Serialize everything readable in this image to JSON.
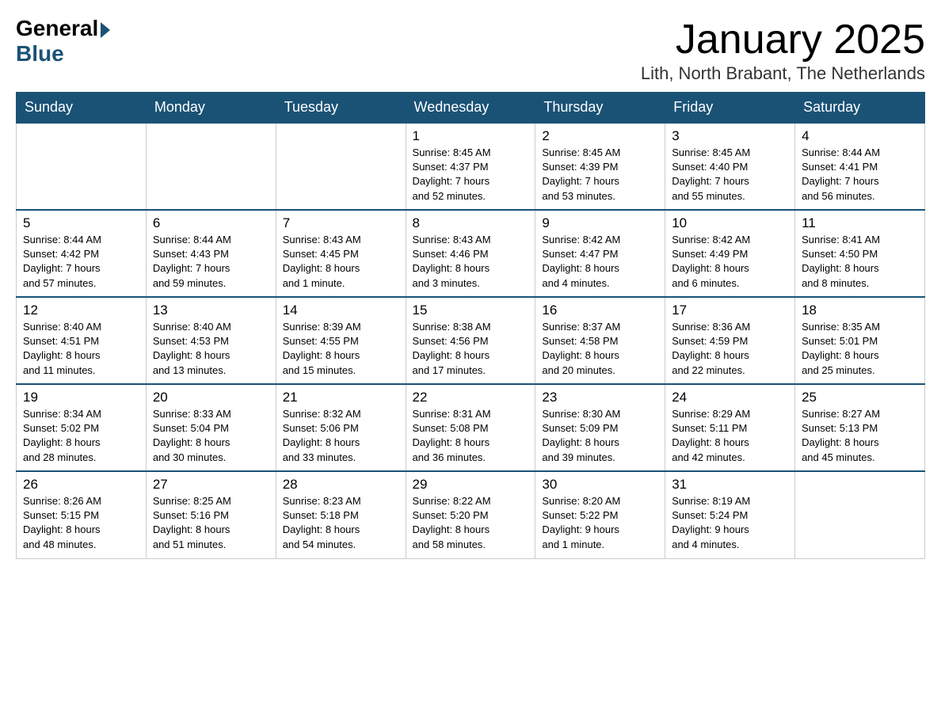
{
  "logo": {
    "general": "General",
    "blue": "Blue"
  },
  "title": "January 2025",
  "location": "Lith, North Brabant, The Netherlands",
  "days_of_week": [
    "Sunday",
    "Monday",
    "Tuesday",
    "Wednesday",
    "Thursday",
    "Friday",
    "Saturday"
  ],
  "weeks": [
    {
      "days": [
        {
          "number": "",
          "info": ""
        },
        {
          "number": "",
          "info": ""
        },
        {
          "number": "",
          "info": ""
        },
        {
          "number": "1",
          "info": "Sunrise: 8:45 AM\nSunset: 4:37 PM\nDaylight: 7 hours\nand 52 minutes."
        },
        {
          "number": "2",
          "info": "Sunrise: 8:45 AM\nSunset: 4:39 PM\nDaylight: 7 hours\nand 53 minutes."
        },
        {
          "number": "3",
          "info": "Sunrise: 8:45 AM\nSunset: 4:40 PM\nDaylight: 7 hours\nand 55 minutes."
        },
        {
          "number": "4",
          "info": "Sunrise: 8:44 AM\nSunset: 4:41 PM\nDaylight: 7 hours\nand 56 minutes."
        }
      ]
    },
    {
      "days": [
        {
          "number": "5",
          "info": "Sunrise: 8:44 AM\nSunset: 4:42 PM\nDaylight: 7 hours\nand 57 minutes."
        },
        {
          "number": "6",
          "info": "Sunrise: 8:44 AM\nSunset: 4:43 PM\nDaylight: 7 hours\nand 59 minutes."
        },
        {
          "number": "7",
          "info": "Sunrise: 8:43 AM\nSunset: 4:45 PM\nDaylight: 8 hours\nand 1 minute."
        },
        {
          "number": "8",
          "info": "Sunrise: 8:43 AM\nSunset: 4:46 PM\nDaylight: 8 hours\nand 3 minutes."
        },
        {
          "number": "9",
          "info": "Sunrise: 8:42 AM\nSunset: 4:47 PM\nDaylight: 8 hours\nand 4 minutes."
        },
        {
          "number": "10",
          "info": "Sunrise: 8:42 AM\nSunset: 4:49 PM\nDaylight: 8 hours\nand 6 minutes."
        },
        {
          "number": "11",
          "info": "Sunrise: 8:41 AM\nSunset: 4:50 PM\nDaylight: 8 hours\nand 8 minutes."
        }
      ]
    },
    {
      "days": [
        {
          "number": "12",
          "info": "Sunrise: 8:40 AM\nSunset: 4:51 PM\nDaylight: 8 hours\nand 11 minutes."
        },
        {
          "number": "13",
          "info": "Sunrise: 8:40 AM\nSunset: 4:53 PM\nDaylight: 8 hours\nand 13 minutes."
        },
        {
          "number": "14",
          "info": "Sunrise: 8:39 AM\nSunset: 4:55 PM\nDaylight: 8 hours\nand 15 minutes."
        },
        {
          "number": "15",
          "info": "Sunrise: 8:38 AM\nSunset: 4:56 PM\nDaylight: 8 hours\nand 17 minutes."
        },
        {
          "number": "16",
          "info": "Sunrise: 8:37 AM\nSunset: 4:58 PM\nDaylight: 8 hours\nand 20 minutes."
        },
        {
          "number": "17",
          "info": "Sunrise: 8:36 AM\nSunset: 4:59 PM\nDaylight: 8 hours\nand 22 minutes."
        },
        {
          "number": "18",
          "info": "Sunrise: 8:35 AM\nSunset: 5:01 PM\nDaylight: 8 hours\nand 25 minutes."
        }
      ]
    },
    {
      "days": [
        {
          "number": "19",
          "info": "Sunrise: 8:34 AM\nSunset: 5:02 PM\nDaylight: 8 hours\nand 28 minutes."
        },
        {
          "number": "20",
          "info": "Sunrise: 8:33 AM\nSunset: 5:04 PM\nDaylight: 8 hours\nand 30 minutes."
        },
        {
          "number": "21",
          "info": "Sunrise: 8:32 AM\nSunset: 5:06 PM\nDaylight: 8 hours\nand 33 minutes."
        },
        {
          "number": "22",
          "info": "Sunrise: 8:31 AM\nSunset: 5:08 PM\nDaylight: 8 hours\nand 36 minutes."
        },
        {
          "number": "23",
          "info": "Sunrise: 8:30 AM\nSunset: 5:09 PM\nDaylight: 8 hours\nand 39 minutes."
        },
        {
          "number": "24",
          "info": "Sunrise: 8:29 AM\nSunset: 5:11 PM\nDaylight: 8 hours\nand 42 minutes."
        },
        {
          "number": "25",
          "info": "Sunrise: 8:27 AM\nSunset: 5:13 PM\nDaylight: 8 hours\nand 45 minutes."
        }
      ]
    },
    {
      "days": [
        {
          "number": "26",
          "info": "Sunrise: 8:26 AM\nSunset: 5:15 PM\nDaylight: 8 hours\nand 48 minutes."
        },
        {
          "number": "27",
          "info": "Sunrise: 8:25 AM\nSunset: 5:16 PM\nDaylight: 8 hours\nand 51 minutes."
        },
        {
          "number": "28",
          "info": "Sunrise: 8:23 AM\nSunset: 5:18 PM\nDaylight: 8 hours\nand 54 minutes."
        },
        {
          "number": "29",
          "info": "Sunrise: 8:22 AM\nSunset: 5:20 PM\nDaylight: 8 hours\nand 58 minutes."
        },
        {
          "number": "30",
          "info": "Sunrise: 8:20 AM\nSunset: 5:22 PM\nDaylight: 9 hours\nand 1 minute."
        },
        {
          "number": "31",
          "info": "Sunrise: 8:19 AM\nSunset: 5:24 PM\nDaylight: 9 hours\nand 4 minutes."
        },
        {
          "number": "",
          "info": ""
        }
      ]
    }
  ]
}
